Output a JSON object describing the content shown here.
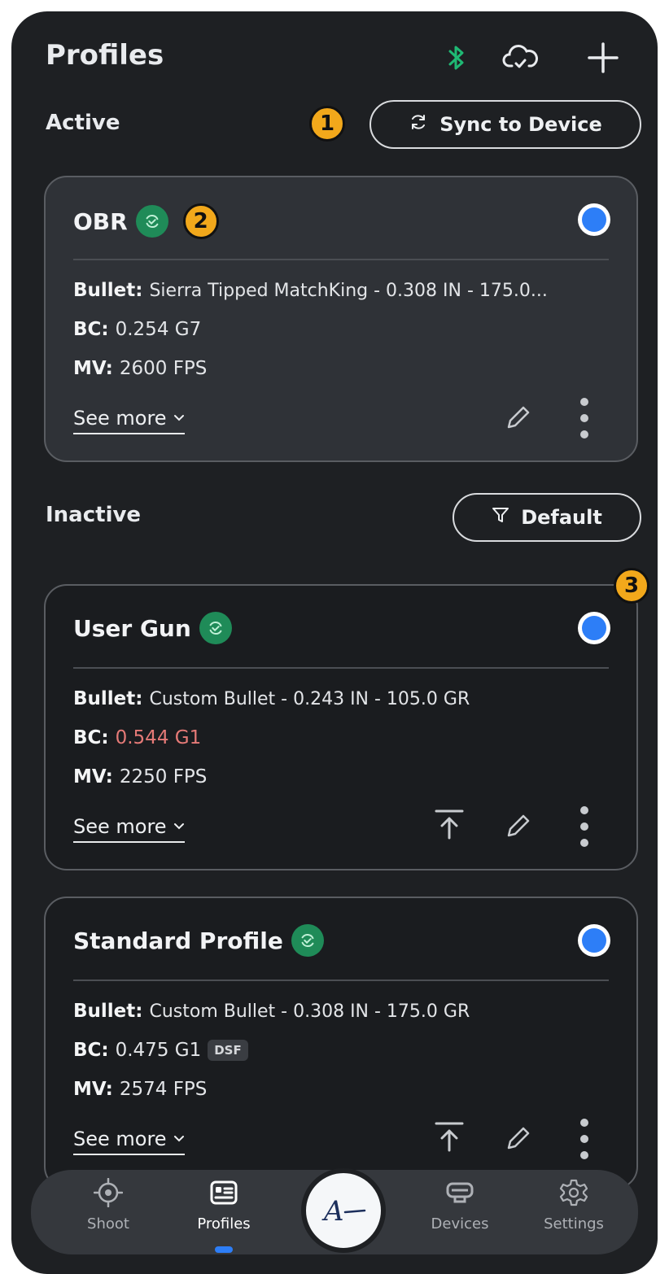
{
  "header": {
    "title": "Profiles",
    "icons": [
      "bluetooth-icon",
      "cloud-sync-icon",
      "plus-icon"
    ],
    "bluetooth_color": "#1fb974"
  },
  "active_section": {
    "label": "Active",
    "sync_button_label": "Sync to Device",
    "marker": "1"
  },
  "active_profile": {
    "name": "OBR",
    "marker": "2",
    "bullet_key": "Bullet:",
    "bullet_value": "Sierra Tipped MatchKing - 0.308 IN - 175.0...",
    "bc_key": "BC:",
    "bc_value": "0.254 G7",
    "mv_key": "MV:",
    "mv_value": "2600 FPS",
    "see_more": "See more",
    "selected": true
  },
  "inactive_section": {
    "label": "Inactive",
    "filter_button_label": "Default",
    "marker": "3"
  },
  "inactive_profiles": [
    {
      "name": "User Gun",
      "bullet_key": "Bullet:",
      "bullet_value": "Custom Bullet - 0.243 IN - 105.0 GR",
      "bc_key": "BC:",
      "bc_value": "0.544 G1",
      "bc_color": "#e57a77",
      "mv_key": "MV:",
      "mv_value": "2250 FPS",
      "see_more": "See more"
    },
    {
      "name": "Standard Profile",
      "bullet_key": "Bullet:",
      "bullet_value": "Custom Bullet - 0.308 IN - 175.0 GR",
      "bc_key": "BC:",
      "bc_value": "0.475 G1",
      "bc_tag": "DSF",
      "mv_key": "MV:",
      "mv_value": "2574 FPS",
      "see_more": "See more"
    }
  ],
  "bottom_nav": {
    "items": [
      {
        "label": "Shoot",
        "icon": "crosshair-icon"
      },
      {
        "label": "Profiles",
        "icon": "profile-card-icon",
        "selected": true
      },
      {
        "label": "Devices",
        "icon": "device-icon"
      },
      {
        "label": "Settings",
        "icon": "gear-icon"
      }
    ],
    "center_logo": "A"
  },
  "colors": {
    "accent_blue": "#2d7ef7",
    "sync_green": "#1f8b58",
    "marker_orange": "#f2a81b",
    "background": "#1e2023"
  }
}
